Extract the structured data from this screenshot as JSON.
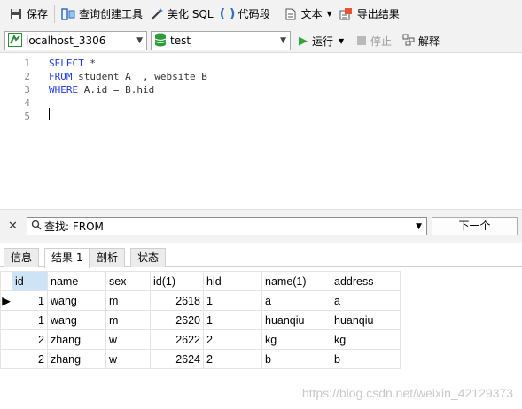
{
  "toolbar": {
    "save": "保存",
    "query_builder": "查询创建工具",
    "beautify_sql": "美化 SQL",
    "code_snippet": "代码段",
    "text": "文本",
    "export_results": "导出结果"
  },
  "connection": {
    "selected": "localhost_3306"
  },
  "database": {
    "selected": "test"
  },
  "actions": {
    "run": "运行",
    "stop": "停止",
    "explain": "解释"
  },
  "editor": {
    "line_numbers": [
      "1",
      "2",
      "3",
      "4",
      "5"
    ],
    "lines": [
      {
        "kw": "SELECT",
        "rest": " *"
      },
      {
        "kw": "FROM",
        "rest": " student A  , website B"
      },
      {
        "kw": "WHERE",
        "rest": " A.id = B.hid"
      },
      {
        "kw": "",
        "rest": ""
      },
      {
        "kw": "",
        "rest": ""
      }
    ]
  },
  "find": {
    "value": "查找: FROM",
    "next_label": "下一个"
  },
  "tabs": [
    {
      "label": "信息",
      "active": false
    },
    {
      "label": "结果 1",
      "active": true
    },
    {
      "label": "剖析",
      "active": false
    },
    {
      "label": "状态",
      "active": false
    }
  ],
  "results": {
    "columns": [
      "id",
      "name",
      "sex",
      "id(1)",
      "hid",
      "name(1)",
      "address"
    ],
    "rows": [
      [
        "1",
        "wang",
        "m",
        "2618",
        "1",
        "a",
        "a"
      ],
      [
        "1",
        "wang",
        "m",
        "2620",
        "1",
        "huanqiu",
        "huanqiu"
      ],
      [
        "2",
        "zhang",
        "w",
        "2622",
        "2",
        "kg",
        "kg"
      ],
      [
        "2",
        "zhang",
        "w",
        "2624",
        "2",
        "b",
        "b"
      ]
    ]
  },
  "watermark": "https://blog.csdn.net/weixin_42129373"
}
